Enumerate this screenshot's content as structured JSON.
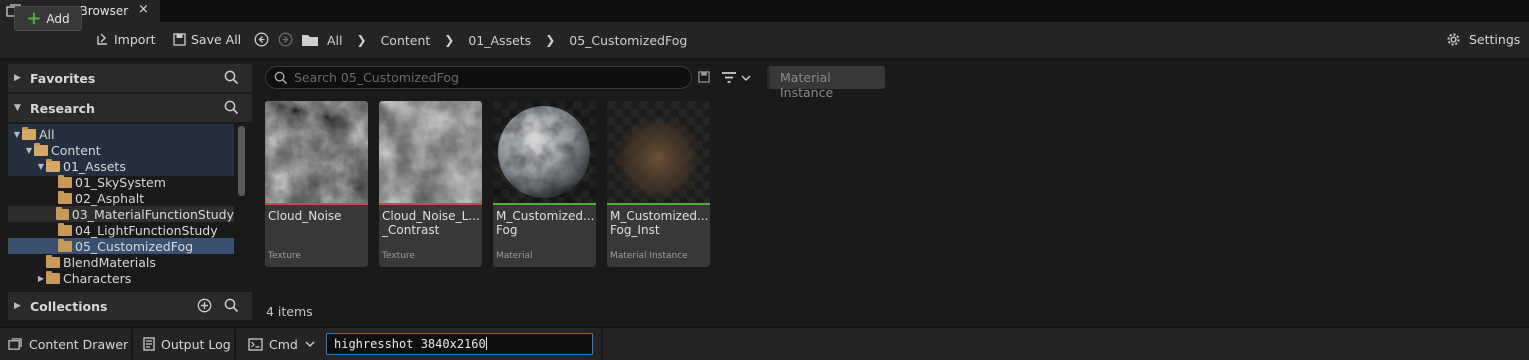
{
  "tab": {
    "title": "Content Browser",
    "close": "×"
  },
  "toolbar": {
    "add": "Add",
    "import": "Import",
    "save_all": "Save All",
    "breadcrumb": [
      "All",
      "Content",
      "01_Assets",
      "05_CustomizedFog"
    ],
    "settings": "Settings"
  },
  "sidebar": {
    "favorites": "Favorites",
    "research": "Research",
    "collections": "Collections",
    "tree": [
      {
        "label": "All",
        "depth": 0,
        "expanded": true
      },
      {
        "label": "Content",
        "depth": 1,
        "expanded": true
      },
      {
        "label": "01_Assets",
        "depth": 2,
        "expanded": true
      },
      {
        "label": "01_SkySystem",
        "depth": 3
      },
      {
        "label": "02_Asphalt",
        "depth": 3
      },
      {
        "label": "03_MaterialFunctionStudy",
        "depth": 3
      },
      {
        "label": "04_LightFunctionStudy",
        "depth": 3
      },
      {
        "label": "05_CustomizedFog",
        "depth": 3,
        "selected": true
      },
      {
        "label": "BlendMaterials",
        "depth": 2
      },
      {
        "label": "Characters",
        "depth": 2,
        "collapsed": true
      }
    ]
  },
  "search": {
    "placeholder": "Search 05_CustomizedFog"
  },
  "filter_chip": "Material Instance",
  "assets": [
    {
      "name": "Cloud_Noise",
      "type": "Texture",
      "color": "#c94a4a"
    },
    {
      "name": "Cloud_Noise_L...\n_Contrast",
      "type": "Texture",
      "color": "#c94a4a"
    },
    {
      "name": "M_Customized...\nFog",
      "type": "Material",
      "color": "#4caf3a"
    },
    {
      "name": "M_Customized...\nFog_Inst",
      "type": "Material Instance",
      "color": "#4caf3a"
    }
  ],
  "item_count": "4 items",
  "bottom": {
    "content_drawer": "Content Drawer",
    "output_log": "Output Log",
    "cmd": "Cmd",
    "command_value": "highresshot 3840x2160"
  }
}
